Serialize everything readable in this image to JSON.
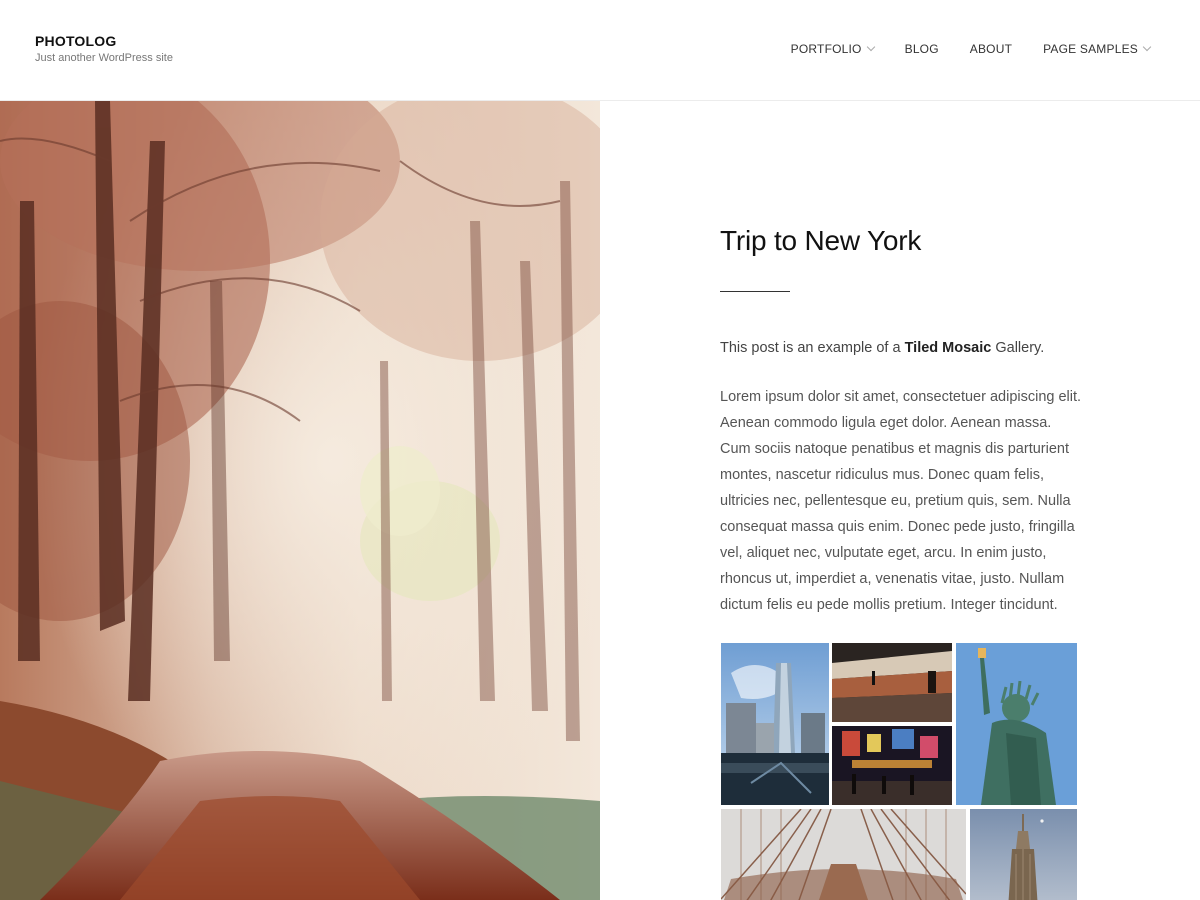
{
  "site": {
    "title": "PHOTOLOG",
    "description": "Just another WordPress site"
  },
  "nav": {
    "items": [
      {
        "label": "PORTFOLIO",
        "has_dropdown": true
      },
      {
        "label": "BLOG",
        "has_dropdown": false
      },
      {
        "label": "ABOUT",
        "has_dropdown": false
      },
      {
        "label": "PAGE SAMPLES",
        "has_dropdown": true
      }
    ]
  },
  "hero": {
    "image": "autumn-forest-path-photo"
  },
  "post": {
    "title": "Trip to New York",
    "intro_before": "This post is an example of a ",
    "intro_strong": "Tiled Mosaic",
    "intro_after": " Gallery.",
    "body": "Lorem ipsum dolor sit amet, consectetuer adipiscing elit. Aenean commodo ligula eget dolor. Aenean massa. Cum sociis natoque penatibus et magnis dis parturient montes, nascetur ridiculus mus. Donec quam felis, ultricies nec, pellentesque eu, pretium quis, sem. Nulla consequat massa quis enim. Donec pede justo, fringilla vel, aliquet nec, vulputate eget, arcu. In enim justo, rhoncus ut, imperdiet a, venenatis vitae, justo. Nullam dictum felis eu pede mollis pretium. Integer tincidunt."
  },
  "gallery": {
    "tiles": [
      {
        "name": "one-world-trade-center-photo"
      },
      {
        "name": "subway-station-photo"
      },
      {
        "name": "times-square-night-photo"
      },
      {
        "name": "statue-of-liberty-photo"
      },
      {
        "name": "brooklyn-bridge-photo"
      },
      {
        "name": "empire-state-building-photo"
      }
    ]
  }
}
